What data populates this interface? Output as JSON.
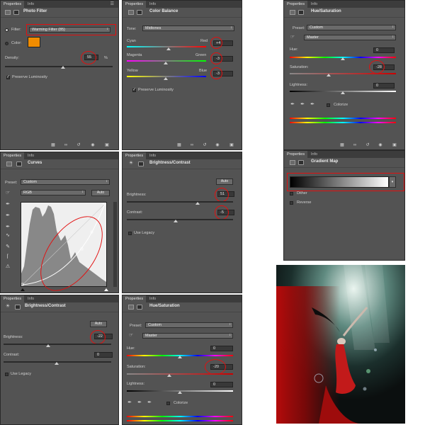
{
  "tabs": {
    "properties": "Properties",
    "info": "Info"
  },
  "photo_filter": {
    "title": "Photo Filter",
    "filter_label": "Filter:",
    "filter_value": "Warming Filter (85)",
    "color_label": "Color:",
    "swatch_color": "#f08c00",
    "density_label": "Density:",
    "density_value": "55",
    "density_unit": "%",
    "density_level_pct": 55,
    "preserve_label": "Preserve Luminosity",
    "preserve_checked": true
  },
  "color_balance": {
    "title": "Color Balance",
    "tone_label": "Tone:",
    "tone_value": "Midtones",
    "sliders": [
      {
        "left": "Cyan",
        "right": "Red",
        "value": "+4"
      },
      {
        "left": "Magenta",
        "right": "Green",
        "value": "-3"
      },
      {
        "left": "Yellow",
        "right": "Blue",
        "value": "-3"
      }
    ],
    "preserve_label": "Preserve Luminosity"
  },
  "hue_sat_1": {
    "title": "Hue/Saturation",
    "preset_label": "Preset:",
    "preset_value": "Custom",
    "channel_value": "Master",
    "hue_label": "Hue:",
    "hue_value": "0",
    "saturation_label": "Saturation:",
    "saturation_value": "-28",
    "lightness_label": "Lightness:",
    "lightness_value": "0",
    "colorize_label": "Colorize"
  },
  "curves": {
    "title": "Curves",
    "preset_label": "Preset:",
    "preset_value": "Custom",
    "channel_value": "RGB",
    "auto_label": "Auto"
  },
  "brightness_contrast_1": {
    "title": "Brightness/Contrast",
    "auto_label": "Auto",
    "brightness_label": "Brightness:",
    "brightness_value": "51",
    "contrast_label": "Contrast:",
    "contrast_value": "-5",
    "legacy_label": "Use Legacy"
  },
  "gradient_map": {
    "title": "Gradient Map",
    "dither_label": "Dither",
    "reverse_label": "Reverse"
  },
  "brightness_contrast_2": {
    "title": "Brightness/Contrast",
    "auto_label": "Auto",
    "brightness_label": "Brightness:",
    "brightness_value": "-22",
    "contrast_label": "Contrast:",
    "contrast_value": "0",
    "legacy_label": "Use Legacy"
  },
  "hue_sat_2": {
    "title": "Hue/Saturation",
    "preset_label": "Preset:",
    "preset_value": "Custom",
    "channel_value": "Master",
    "hue_label": "Hue:",
    "hue_value": "0",
    "saturation_label": "Saturation:",
    "saturation_value": "-20",
    "lightness_label": "Lightness:",
    "lightness_value": "0",
    "colorize_label": "Colorize"
  },
  "colors": {
    "highlight": "#e21010",
    "panel": "#535353",
    "accent_orange": "#f08c00"
  }
}
